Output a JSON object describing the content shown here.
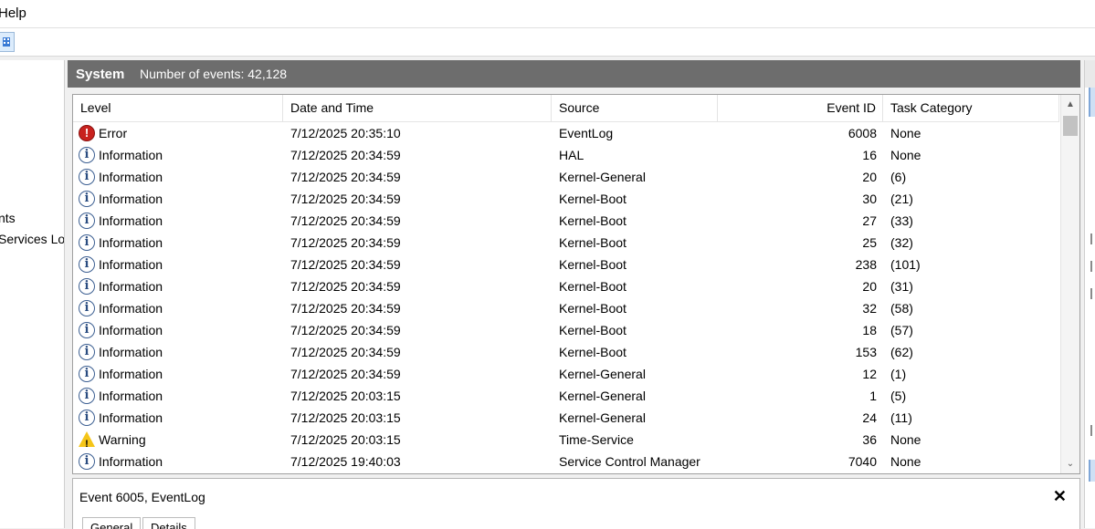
{
  "menu": {
    "help_label": "Help"
  },
  "tree": {
    "items": [
      {
        "label": "nts"
      },
      {
        "label": "Services Lo"
      }
    ]
  },
  "header": {
    "log_name": "System",
    "count_text": "Number of events: 42,128"
  },
  "columns": {
    "level": "Level",
    "datetime": "Date and Time",
    "source": "Source",
    "event_id": "Event ID",
    "task_category": "Task Category"
  },
  "rows": [
    {
      "level": "Error",
      "icon": "error-icon",
      "datetime": "7/12/2025 20:35:10",
      "source": "EventLog",
      "event_id": "6008",
      "task_category": "None"
    },
    {
      "level": "Information",
      "icon": "info-icon",
      "datetime": "7/12/2025 20:34:59",
      "source": "HAL",
      "event_id": "16",
      "task_category": "None"
    },
    {
      "level": "Information",
      "icon": "info-icon",
      "datetime": "7/12/2025 20:34:59",
      "source": "Kernel-General",
      "event_id": "20",
      "task_category": "(6)"
    },
    {
      "level": "Information",
      "icon": "info-icon",
      "datetime": "7/12/2025 20:34:59",
      "source": "Kernel-Boot",
      "event_id": "30",
      "task_category": "(21)"
    },
    {
      "level": "Information",
      "icon": "info-icon",
      "datetime": "7/12/2025 20:34:59",
      "source": "Kernel-Boot",
      "event_id": "27",
      "task_category": "(33)"
    },
    {
      "level": "Information",
      "icon": "info-icon",
      "datetime": "7/12/2025 20:34:59",
      "source": "Kernel-Boot",
      "event_id": "25",
      "task_category": "(32)"
    },
    {
      "level": "Information",
      "icon": "info-icon",
      "datetime": "7/12/2025 20:34:59",
      "source": "Kernel-Boot",
      "event_id": "238",
      "task_category": "(101)"
    },
    {
      "level": "Information",
      "icon": "info-icon",
      "datetime": "7/12/2025 20:34:59",
      "source": "Kernel-Boot",
      "event_id": "20",
      "task_category": "(31)"
    },
    {
      "level": "Information",
      "icon": "info-icon",
      "datetime": "7/12/2025 20:34:59",
      "source": "Kernel-Boot",
      "event_id": "32",
      "task_category": "(58)"
    },
    {
      "level": "Information",
      "icon": "info-icon",
      "datetime": "7/12/2025 20:34:59",
      "source": "Kernel-Boot",
      "event_id": "18",
      "task_category": "(57)"
    },
    {
      "level": "Information",
      "icon": "info-icon",
      "datetime": "7/12/2025 20:34:59",
      "source": "Kernel-Boot",
      "event_id": "153",
      "task_category": "(62)"
    },
    {
      "level": "Information",
      "icon": "info-icon",
      "datetime": "7/12/2025 20:34:59",
      "source": "Kernel-General",
      "event_id": "12",
      "task_category": "(1)"
    },
    {
      "level": "Information",
      "icon": "info-icon",
      "datetime": "7/12/2025 20:03:15",
      "source": "Kernel-General",
      "event_id": "1",
      "task_category": "(5)"
    },
    {
      "level": "Information",
      "icon": "info-icon",
      "datetime": "7/12/2025 20:03:15",
      "source": "Kernel-General",
      "event_id": "24",
      "task_category": "(11)"
    },
    {
      "level": "Warning",
      "icon": "warning-icon",
      "datetime": "7/12/2025 20:03:15",
      "source": "Time-Service",
      "event_id": "36",
      "task_category": "None"
    },
    {
      "level": "Information",
      "icon": "info-icon",
      "datetime": "7/12/2025 19:40:03",
      "source": "Service Control Manager",
      "event_id": "7040",
      "task_category": "None"
    }
  ],
  "detail": {
    "title": "Event 6005, EventLog",
    "close_glyph": "✕",
    "tabs": [
      {
        "label": "General"
      },
      {
        "label": "Details"
      }
    ]
  },
  "scroll": {
    "up_glyph": "▲",
    "down_glyph": "⌄"
  },
  "colors": {
    "header_bar": "#6d6d6d",
    "error": "#c8221e",
    "warning": "#f5c518",
    "info": "#3b5e91"
  }
}
